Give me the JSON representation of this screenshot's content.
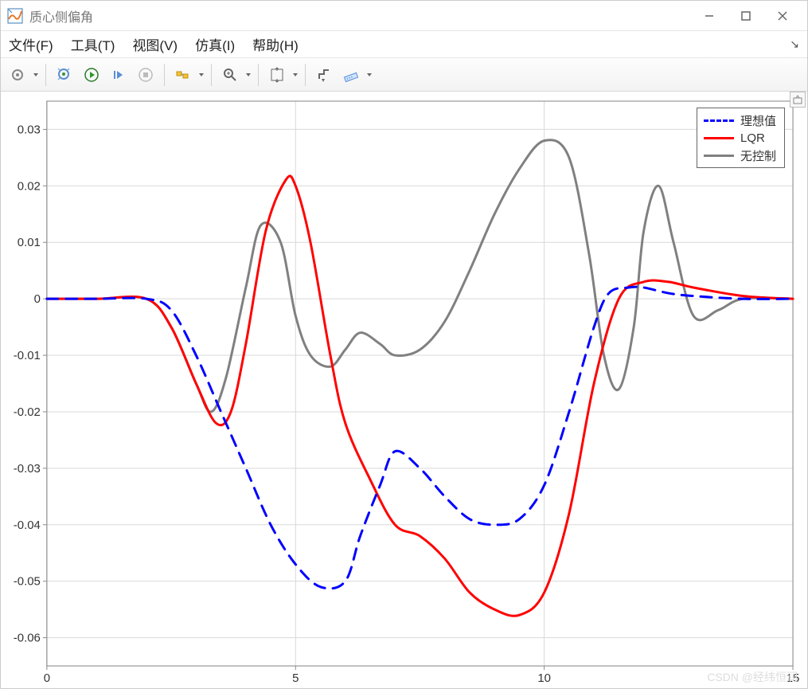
{
  "window": {
    "title": "质心侧偏角"
  },
  "menu": {
    "file": "文件(F)",
    "tools": "工具(T)",
    "view": "视图(V)",
    "simulation": "仿真(I)",
    "help": "帮助(H)"
  },
  "legend": {
    "ideal": "理想值",
    "lqr": "LQR",
    "nocontrol": "无控制"
  },
  "watermark": "CSDN @经纬恒润",
  "chart_data": {
    "type": "line",
    "title": "",
    "xlabel": "",
    "ylabel": "",
    "xlim": [
      0,
      15
    ],
    "ylim": [
      -0.065,
      0.035
    ],
    "xticks": [
      0,
      5,
      10,
      15
    ],
    "yticks": [
      -0.06,
      -0.05,
      -0.04,
      -0.03,
      -0.02,
      -0.01,
      0,
      0.01,
      0.02,
      0.03
    ],
    "legend_position": "top-right",
    "grid": true,
    "series": [
      {
        "name": "理想值",
        "color": "#0000ff",
        "style": "dashed",
        "x": [
          0,
          1,
          2,
          2.5,
          3,
          3.5,
          4,
          4.5,
          5,
          5.5,
          6,
          6.3,
          6.7,
          7,
          7.5,
          8,
          8.5,
          9,
          9.5,
          10,
          10.5,
          11,
          11.3,
          11.7,
          12,
          12.5,
          13,
          14,
          15
        ],
        "y": [
          0,
          0,
          0,
          -0.002,
          -0.01,
          -0.02,
          -0.03,
          -0.04,
          -0.047,
          -0.051,
          -0.05,
          -0.042,
          -0.033,
          -0.027,
          -0.03,
          -0.035,
          -0.039,
          -0.04,
          -0.039,
          -0.033,
          -0.02,
          -0.005,
          0.001,
          0.002,
          0.002,
          0.001,
          0.0005,
          0,
          0
        ]
      },
      {
        "name": "LQR",
        "color": "#ff0000",
        "style": "solid",
        "x": [
          0,
          1,
          2,
          2.5,
          3,
          3.4,
          3.7,
          4,
          4.4,
          4.8,
          5,
          5.3,
          5.7,
          6,
          6.5,
          7,
          7.5,
          8,
          8.5,
          9,
          9.5,
          10,
          10.5,
          11,
          11.5,
          12,
          12.5,
          13,
          14,
          15
        ],
        "y": [
          0,
          0,
          0,
          -0.005,
          -0.015,
          -0.022,
          -0.02,
          -0.008,
          0.012,
          0.021,
          0.02,
          0.01,
          -0.01,
          -0.022,
          -0.032,
          -0.04,
          -0.042,
          -0.046,
          -0.052,
          -0.055,
          -0.056,
          -0.052,
          -0.038,
          -0.015,
          0.0,
          0.003,
          0.003,
          0.002,
          0.0005,
          0
        ]
      },
      {
        "name": "无控制",
        "color": "#808080",
        "style": "solid",
        "x": [
          0,
          1,
          2,
          2.5,
          3,
          3.3,
          3.6,
          4,
          4.3,
          4.7,
          5,
          5.3,
          5.7,
          6,
          6.3,
          6.7,
          7,
          7.5,
          8,
          8.5,
          9,
          9.5,
          10,
          10.5,
          10.9,
          11.2,
          11.5,
          11.8,
          12,
          12.3,
          12.6,
          13,
          13.5,
          14,
          15
        ],
        "y": [
          0,
          0,
          0,
          -0.005,
          -0.015,
          -0.02,
          -0.014,
          0.002,
          0.013,
          0.01,
          -0.003,
          -0.01,
          -0.012,
          -0.009,
          -0.006,
          -0.008,
          -0.01,
          -0.009,
          -0.004,
          0.005,
          0.015,
          0.023,
          0.028,
          0.025,
          0.008,
          -0.01,
          -0.016,
          -0.005,
          0.012,
          0.02,
          0.01,
          -0.003,
          -0.002,
          0,
          0
        ]
      }
    ]
  }
}
